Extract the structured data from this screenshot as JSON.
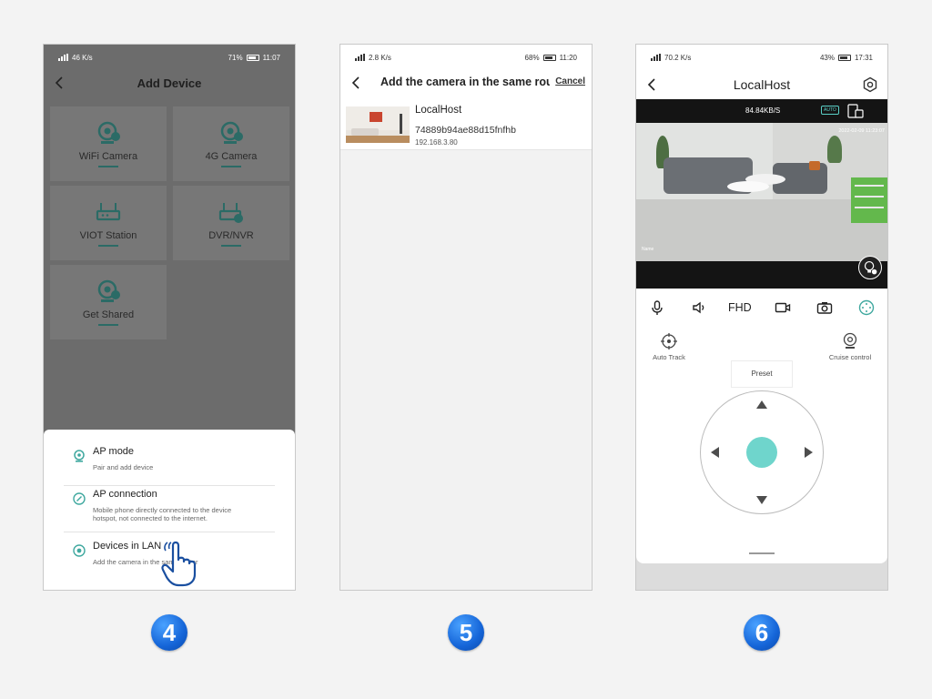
{
  "colors": {
    "teal": "#3fa89f",
    "step_badge": "#1565d8",
    "dpad_center": "#6fd5cc"
  },
  "screen1": {
    "status": {
      "left": "46 K/s",
      "battery": "71%",
      "time": "11:07"
    },
    "title": "Add Device",
    "tiles": [
      {
        "label": "WiFi Camera",
        "icon": "wifi-camera-icon"
      },
      {
        "label": "4G Camera",
        "icon": "4g-camera-icon"
      },
      {
        "label": "VIOT Station",
        "icon": "router-icon"
      },
      {
        "label": "DVR/NVR",
        "icon": "dvr-icon"
      },
      {
        "label": "Get Shared",
        "icon": "shared-camera-icon"
      }
    ],
    "options": [
      {
        "title": "AP mode",
        "desc": "Pair and add device"
      },
      {
        "title": "AP connection",
        "desc": "Mobile phone directly connected to the device hotspot, not connected to the internet."
      },
      {
        "title": "Devices in LAN",
        "desc": "Add the camera in the same router"
      }
    ]
  },
  "screen2": {
    "status": {
      "left": "2.8 K/s",
      "battery": "68%",
      "time": "11:20"
    },
    "title": "Add the camera in the same router",
    "cancel": "Cancel",
    "device": {
      "name": "LocalHost",
      "id": "74889b94ae88d15fnfhb",
      "ip": "192.168.3.80"
    }
  },
  "screen3": {
    "status": {
      "left": "70.2 K/s",
      "battery": "43%",
      "time": "17:31"
    },
    "title": "LocalHost",
    "speed": "84.84KB/S",
    "auto_badge": "AUTO",
    "timestamp": "2022-02-09 11:23:07",
    "camera_name": "Name",
    "quality": "FHD",
    "auto_track": "Auto Track",
    "cruise": "Cruise control",
    "preset": "Preset"
  },
  "steps": [
    "4",
    "5",
    "6"
  ]
}
